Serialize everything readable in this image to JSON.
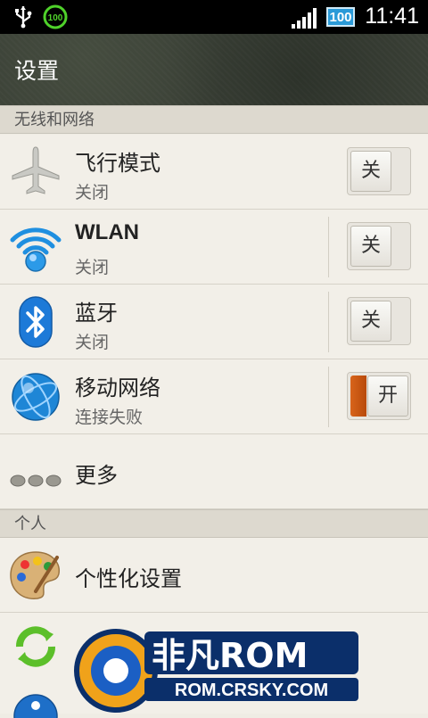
{
  "status_bar": {
    "battery_circle": "100",
    "battery_level": "100",
    "time": "11:41",
    "icons": [
      "usb-icon",
      "battery-full-notification-icon",
      "signal-icon",
      "battery-icon"
    ]
  },
  "header": {
    "title": "设置"
  },
  "sections": [
    {
      "label": "无线和网络"
    },
    {
      "label": "个人"
    }
  ],
  "rows": [
    {
      "title": "飞行模式",
      "subtitle": "关闭",
      "toggle": "关",
      "toggle_on": false,
      "icon": "airplane-icon"
    },
    {
      "title": "WLAN",
      "subtitle": "关闭",
      "toggle": "关",
      "toggle_on": false,
      "icon": "wifi-icon"
    },
    {
      "title": "蓝牙",
      "subtitle": "关闭",
      "toggle": "关",
      "toggle_on": false,
      "icon": "bluetooth-icon"
    },
    {
      "title": "移动网络",
      "subtitle": "连接失败",
      "toggle": "开",
      "toggle_on": true,
      "icon": "globe-icon"
    },
    {
      "title": "更多",
      "icon": "more-icon"
    },
    {
      "title": "个性化设置",
      "icon": "palette-icon"
    }
  ],
  "watermark": {
    "brand": "非凡ROM",
    "site": "ROM.CRSKY.COM"
  },
  "colors": {
    "toggle_on": "#d8641a",
    "header_bg": "#3a4036",
    "accent_blue": "#2a9ad8"
  }
}
